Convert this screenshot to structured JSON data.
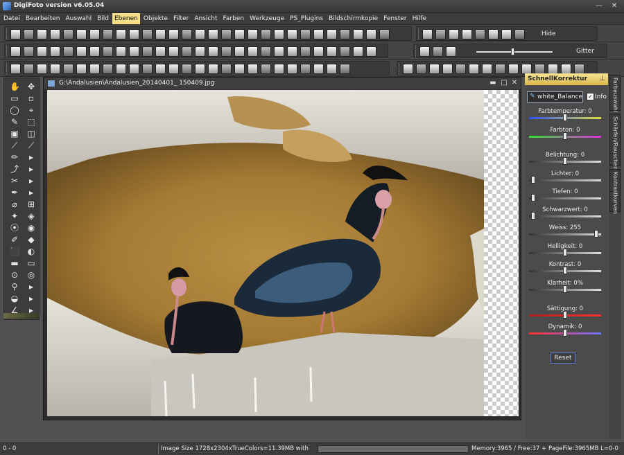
{
  "window": {
    "title": "DigiFoto version v6.05.04",
    "minimize": "—",
    "close": "✕"
  },
  "menu": [
    "Datei",
    "Bearbeiten",
    "Auswahl",
    "Bild",
    "Ebenen",
    "Objekte",
    "Filter",
    "Ansicht",
    "Farben",
    "Werkzeuge",
    "PS_Plugins",
    "Bildschirmkopie",
    "Fenster",
    "Hilfe"
  ],
  "menu_active": "Ebenen",
  "toolbar": {
    "hide_label": "Hide",
    "gitter_label": "Gitter"
  },
  "document": {
    "title": "G:\\Andalusien\\Andalusien_20140401_ 150409.jpg",
    "minimize": "▬",
    "maximize": "□",
    "close": "✕"
  },
  "panel": {
    "title": "SchnellKorrektur",
    "white_balance_button": "white_Balance",
    "info_label": "Info",
    "info_checked": true,
    "sliders": [
      {
        "label": "Farbtemperatur: 0",
        "value": 0,
        "track": "blue-yellow"
      },
      {
        "label": "Farbton: 0",
        "value": 0,
        "track": "green-magenta"
      },
      {
        "label": "Belichtung: 0",
        "value": 0,
        "track": "gray"
      },
      {
        "label": "Lichter: 0",
        "value": 0,
        "track": "gray"
      },
      {
        "label": "Tiefen: 0",
        "value": 0,
        "track": "gray"
      },
      {
        "label": "Schwarzwert: 0",
        "value": 0,
        "track": "gray"
      },
      {
        "label": "Weiss: 255",
        "value": 255,
        "track": "gray"
      },
      {
        "label": "Helligkeit: 0",
        "value": 0,
        "track": "gray"
      },
      {
        "label": "Kontrast: 0",
        "value": 0,
        "track": "gray"
      },
      {
        "label": "Klarheit: 0%",
        "value": 0,
        "track": "gray"
      },
      {
        "label": "Sättigung: 0",
        "value": 0,
        "track": "red"
      },
      {
        "label": "Dynamik: 0",
        "value": 0,
        "track": "red-blue"
      }
    ],
    "reset_label": "Reset"
  },
  "side_tabs": [
    "Farbauswahl",
    "Schärfen/Rauschen",
    "Kontrastkurven"
  ],
  "status": {
    "coords": "0 - 0",
    "image_info": "Image Size 1728x2304xTrueColors=11.39MB  with",
    "memory": "Memory:3965 / Free:37 + PageFile:3965MB L=0-0"
  },
  "colors": {
    "accent": "#f7e08a",
    "panel_bg": "#4b4b4b",
    "window_bg": "#505050"
  }
}
